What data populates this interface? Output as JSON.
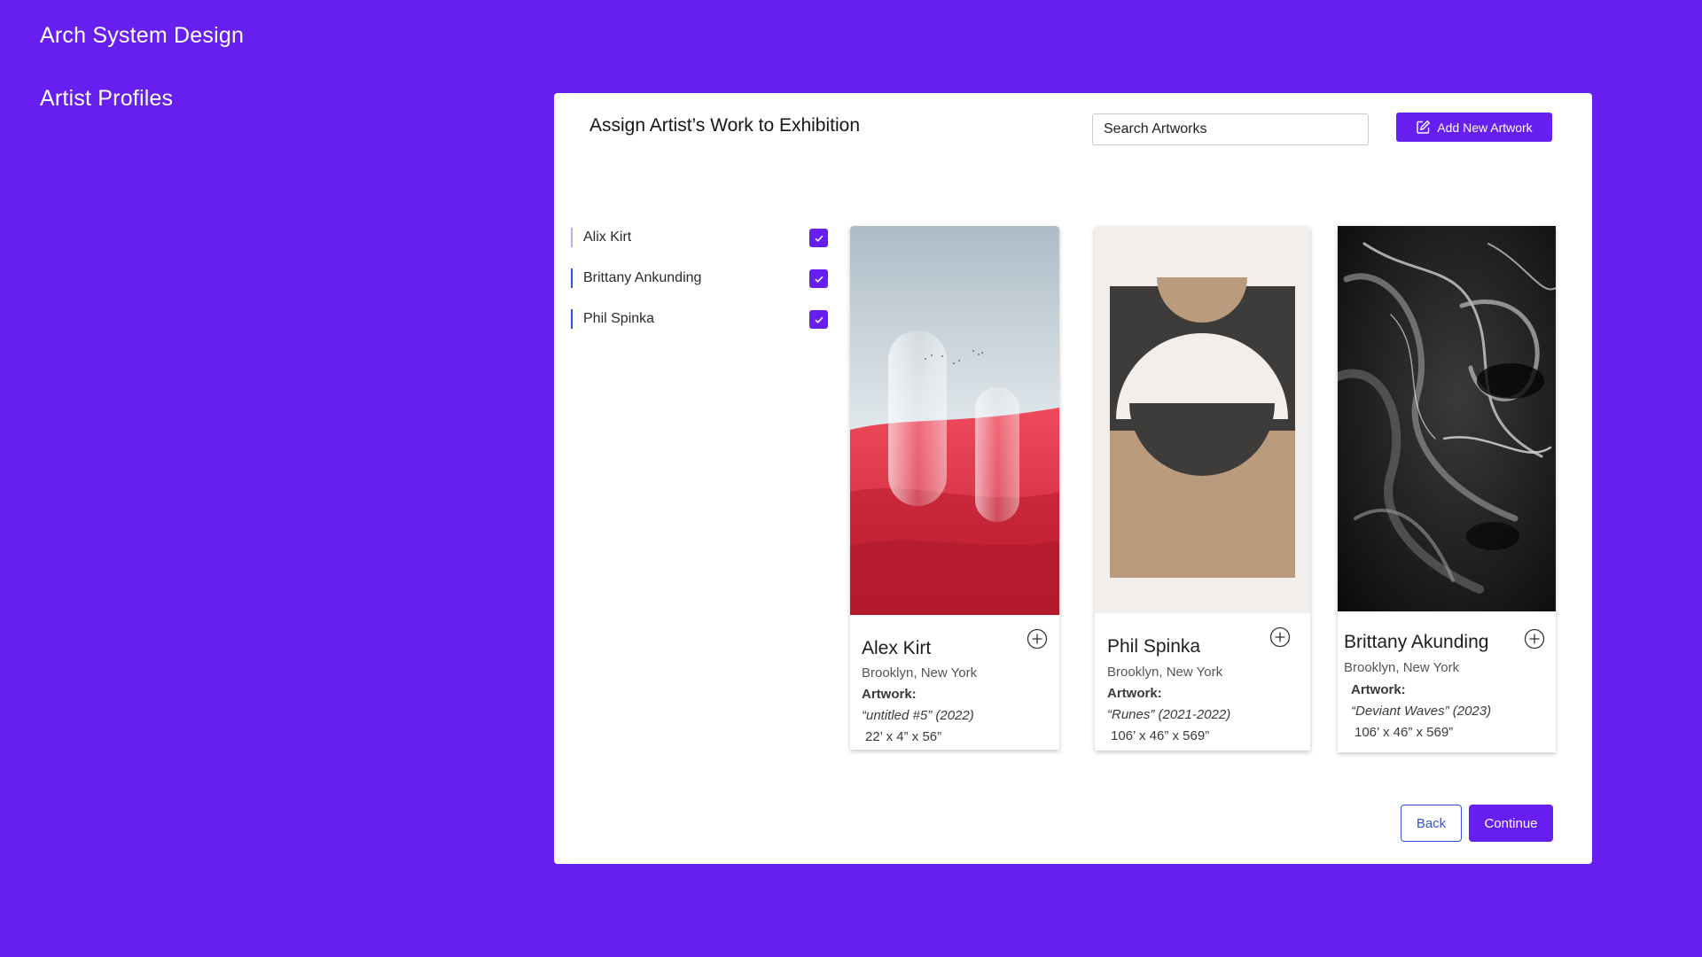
{
  "app": {
    "title": "Arch System Design"
  },
  "nav": {
    "section_title": "Artist Profiles"
  },
  "panel": {
    "title": "Assign Artist’s Work to Exhibition",
    "search_placeholder": "Search Artworks",
    "add_button_label": "Add New Artwork",
    "artists": [
      {
        "name": "Alix Kirt",
        "checked": true
      },
      {
        "name": "Brittany Ankunding",
        "checked": true
      },
      {
        "name": "Phil Spinka",
        "checked": true
      }
    ],
    "cards": [
      {
        "artist": "Alex Kirt",
        "location": "Brooklyn, New York",
        "artwork_label": "Artwork:",
        "artwork_title": "“untitled #5” (2022)",
        "dimensions": "22’ x 4” x 56”"
      },
      {
        "artist": "Phil Spinka",
        "location": "Brooklyn, New York",
        "artwork_label": "Artwork:",
        "artwork_title": "“Runes” (2021-2022)",
        "dimensions": "106’ x 46” x 569”"
      },
      {
        "artist": "Brittany Akunding",
        "location": "Brooklyn, New York",
        "artwork_label": "Artwork:",
        "artwork_title": "“Deviant Waves” (2023)",
        "dimensions": "106’ x 46” x 569”"
      }
    ],
    "back_label": "Back",
    "continue_label": "Continue"
  },
  "colors": {
    "brand": "#661ff0",
    "accent_blue": "#2f55d4"
  },
  "icons": {
    "add_artwork": "edit-square-icon",
    "add_to_exhibition": "plus-circle-icon",
    "checkbox": "check-icon"
  }
}
